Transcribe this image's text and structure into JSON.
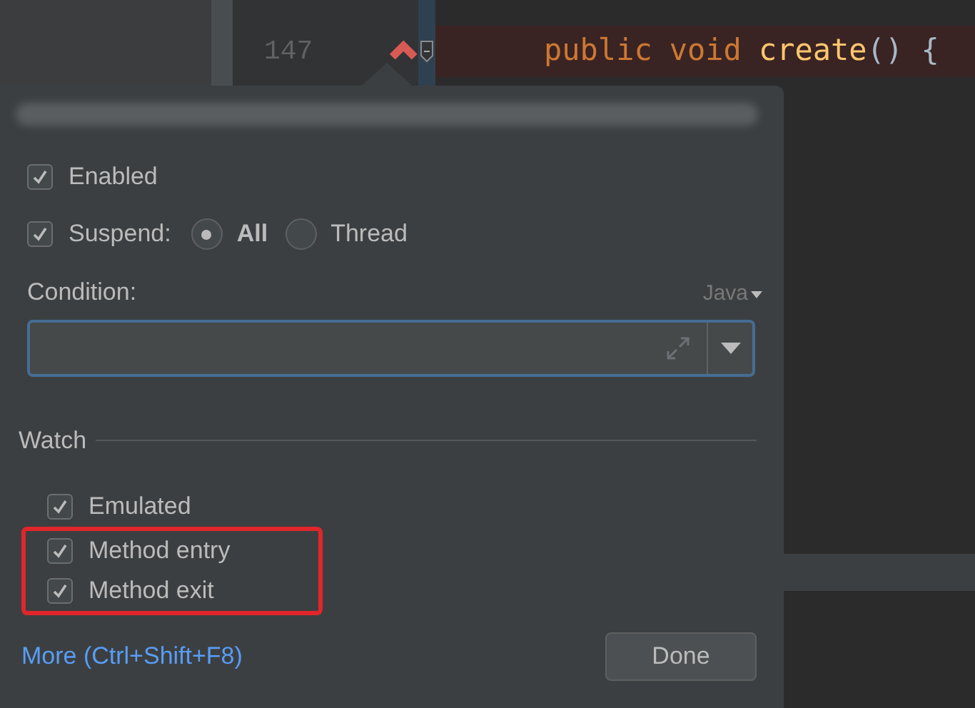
{
  "editor": {
    "lines": [
      {
        "number": "147",
        "breakpoint": true,
        "tokens": [
          {
            "kind": "keyword",
            "text": "public"
          },
          {
            "kind": "keyword",
            "text": "void"
          },
          {
            "kind": "function",
            "text": "create"
          },
          {
            "kind": "punct",
            "text": "() {"
          }
        ]
      }
    ]
  },
  "popup": {
    "enabled": {
      "label": "Enabled",
      "checked": true
    },
    "suspend": {
      "label": "Suspend:",
      "checked": true,
      "options": [
        {
          "label": "All",
          "selected": true
        },
        {
          "label": "Thread",
          "selected": false
        }
      ]
    },
    "condition": {
      "label": "Condition:",
      "language": "Java"
    },
    "watch": {
      "label": "Watch",
      "items": [
        {
          "label": "Emulated",
          "checked": true,
          "highlighted": false
        },
        {
          "label": "Method entry",
          "checked": true,
          "highlighted": true
        },
        {
          "label": "Method exit",
          "checked": true,
          "highlighted": true
        }
      ]
    },
    "more_link": "More (Ctrl+Shift+F8)",
    "done_button": "Done"
  }
}
